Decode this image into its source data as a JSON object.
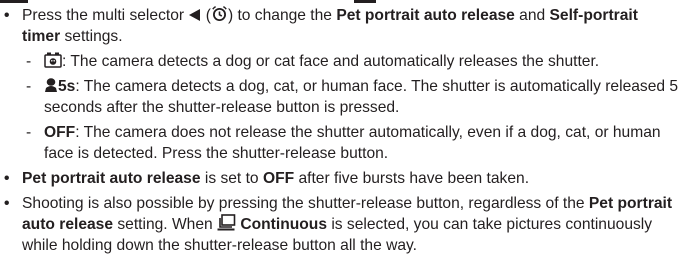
{
  "colors": {
    "text": "#231f20",
    "background": "#ffffff"
  },
  "bullets": [
    {
      "segments": [
        {
          "text": "Press the multi selector ",
          "bold": false
        },
        {
          "icon": "multi-selector-left-icon"
        },
        {
          "text": " (",
          "bold": false
        },
        {
          "icon": "self-timer-icon"
        },
        {
          "text": ") to change the ",
          "bold": false
        },
        {
          "text": "Pet portrait auto release",
          "bold": true
        },
        {
          "text": " and ",
          "bold": false
        },
        {
          "text": "Self-portrait timer",
          "bold": true
        },
        {
          "text": " settings.",
          "bold": false
        }
      ],
      "subitems": [
        {
          "icon": "pet-portrait-auto-release-icon",
          "segments": [
            {
              "text": ": The camera detects a dog or cat face and automatically releases the shutter.",
              "bold": false
            }
          ]
        },
        {
          "icon": "self-portrait-timer-icon",
          "segments": [
            {
              "text": "5s",
              "bold": true
            },
            {
              "text": ": The camera detects a dog, cat, or human face. The shutter is automatically released 5 seconds after the shutter-release button is pressed.",
              "bold": false
            }
          ]
        },
        {
          "segments": [
            {
              "text": "OFF",
              "bold": true
            },
            {
              "text": ": The camera does not release the shutter automatically, even if a dog, cat, or human face is detected. Press the shutter-release button.",
              "bold": false
            }
          ]
        }
      ]
    },
    {
      "segments": [
        {
          "text": "Pet portrait auto release",
          "bold": true
        },
        {
          "text": " is set to ",
          "bold": false
        },
        {
          "text": "OFF",
          "bold": true
        },
        {
          "text": " after five bursts have been taken.",
          "bold": false
        }
      ]
    },
    {
      "segments": [
        {
          "text": "Shooting is also possible by pressing the shutter-release button, regardless of the ",
          "bold": false
        },
        {
          "text": "Pet portrait auto release",
          "bold": true
        },
        {
          "text": " setting. When ",
          "bold": false
        },
        {
          "icon": "continuous-icon"
        },
        {
          "text": " ",
          "bold": false
        },
        {
          "text": "Continuous",
          "bold": true
        },
        {
          "text": " is selected, you can take pictures continuously while holding down the shutter-release button all the way.",
          "bold": false
        }
      ]
    }
  ]
}
